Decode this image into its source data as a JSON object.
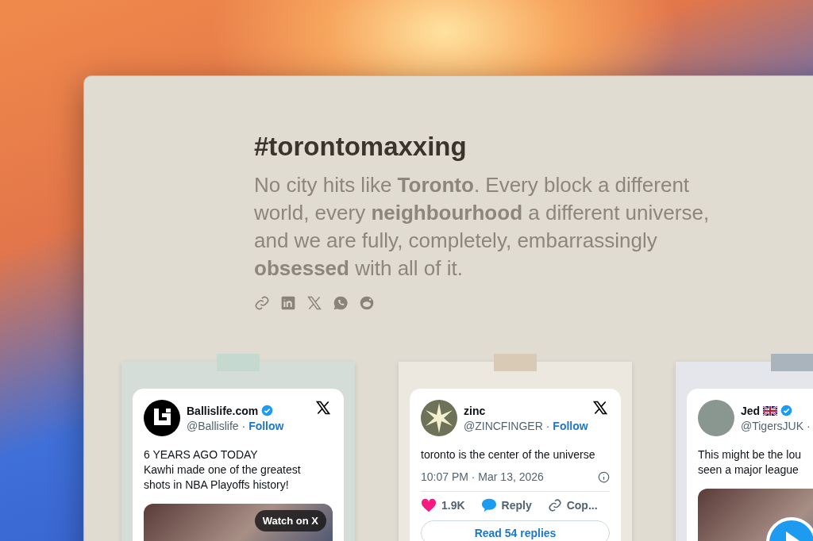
{
  "window": {
    "title": "#torontomaxxing",
    "intro": "No city hits like **Toronto**. Every block a different world, every **neighbourhood** a different universe, and we are fully, completely, embarrassingly **obsessed** with all of it."
  },
  "posts": [
    {
      "kind": "video",
      "tape": {
        "color": "#c5d9d0"
      },
      "paper": {
        "color": "#d4ddd8"
      },
      "avatar": {
        "kind": "logo"
      },
      "name": "Ballislife.com",
      "flag": false,
      "verified": true,
      "handle": "@Ballislife ·",
      "follow": "Follow",
      "text": "6 YEARS AGO TODAY\nKawhi made one of the greatest shots in NBA Playoffs history!",
      "media_label": "Watch on X",
      "play": false
    },
    {
      "kind": "stats",
      "tape": {
        "color": "#d9cab5"
      },
      "paper": {
        "color": "#ece8e0"
      },
      "avatar": {
        "kind": "star"
      },
      "name": "zinc",
      "flag": false,
      "verified": false,
      "handle": "@ZINCFINGER ·",
      "follow": "Follow",
      "text": "toronto is the center of the universe",
      "time": "10:07 PM · Mar 13, 2026",
      "likes": "1.9K",
      "reply": "Reply",
      "copy": "Cop...",
      "read": "Read 54 replies"
    },
    {
      "kind": "video",
      "tape": {
        "color": "#aab4bd"
      },
      "paper": {
        "color": "#e4e6ec"
      },
      "avatar": {
        "kind": "photo"
      },
      "name": "Jed",
      "flag": true,
      "verified": true,
      "handle": "@TigersJUK ·",
      "text": "This might be the lou\nseen a major league",
      "play": true
    }
  ]
}
